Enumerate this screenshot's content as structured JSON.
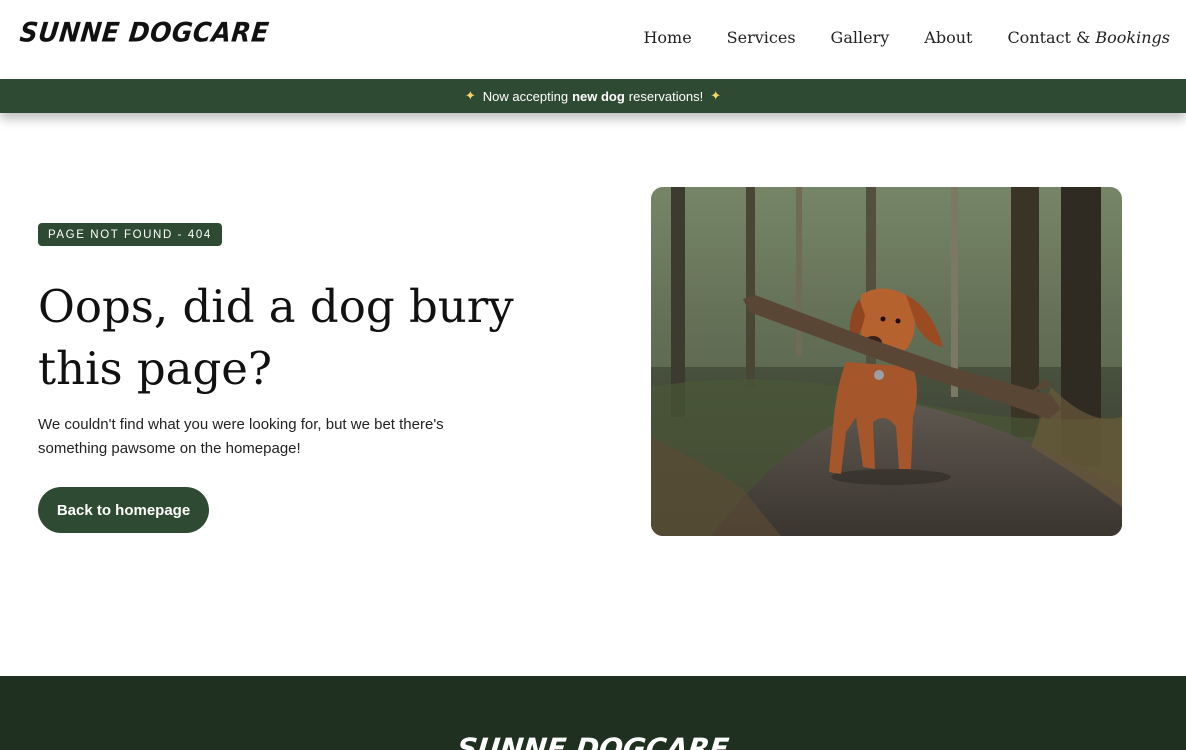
{
  "header": {
    "logo": "SUNNE DOGCARE",
    "nav": {
      "home": "Home",
      "services": "Services",
      "gallery": "Gallery",
      "about": "About",
      "contact": "Contact &",
      "bookings": "Bookings"
    }
  },
  "banner": {
    "prefix": "Now accepting",
    "emphasis": "new dog",
    "suffix": "reservations!",
    "icon": "sparkle-icon"
  },
  "main": {
    "badge": "PAGE NOT FOUND - 404",
    "headline": "Oops, did a dog bury this page?",
    "subtext": "We couldn't find what you were looking for, but we bet there's something pawsome on the homepage!",
    "button": "Back to homepage",
    "image_alt": "dog carrying stick"
  },
  "footer": {
    "logo": "SUNNE DOGCARE"
  },
  "colors": {
    "brand_green": "#2f4a32",
    "footer_green": "#1f3021"
  }
}
